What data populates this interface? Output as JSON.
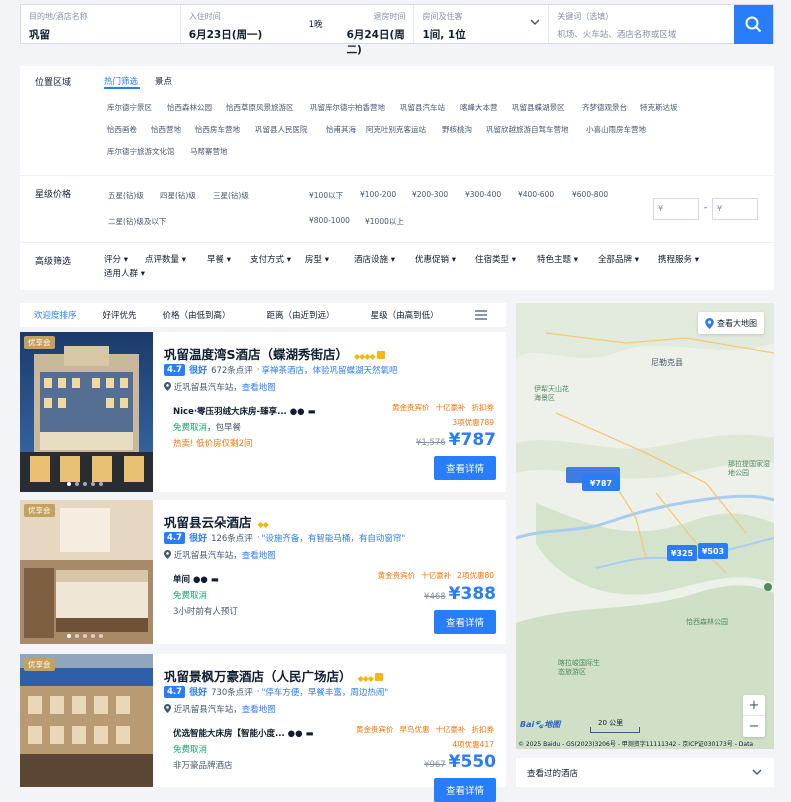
{
  "search": {
    "dest_label": "目的地/酒店名称",
    "dest_value": "巩留",
    "checkin_label": "入住时间",
    "checkin_value": "6月23日(周一)",
    "nights": "1晚",
    "checkout_label": "退房时间",
    "checkout_value": "6月24日(周二)",
    "guests_label": "房间及住客",
    "guests_value": "1间, 1位",
    "keyword_label": "关键词（选填）",
    "keyword_placeholder": "机场、火车站、酒店名称或区域"
  },
  "filters": {
    "location_label": "位置区域",
    "loc_tabs": [
      "热门筛选",
      "景点"
    ],
    "loc_row1": [
      "库尔德宁景区",
      "恰西森林公园",
      "恰西草原风景旅游区",
      "巩留库尔德宁柏香营地",
      "巩留县汽车站",
      "喀峰大本营",
      "巩留县蝶湖景区",
      "齐梦德观景台",
      "特克斯达坂"
    ],
    "loc_row2": [
      "恰西画卷",
      "恰西营地",
      "恰西房车营地",
      "巩留县人民医院",
      "恰甫其海",
      "阿克吐别克客运站",
      "野核桃沟",
      "巩留欣越旅游自驾车营地",
      "小喜山雨房车营地"
    ],
    "loc_row3": [
      "库尔德宁旅游文化馆",
      "马帮寨营地"
    ],
    "star_label": "星级价格",
    "stars_row1": [
      "五星(钻)级",
      "四星(钻)级",
      "三星(钻)级"
    ],
    "stars_row2": [
      "二星(钻)级及以下"
    ],
    "prices_row1": [
      "¥100以下",
      "¥100-200",
      "¥200-300",
      "¥300-400",
      "¥400-600",
      "¥600-800"
    ],
    "prices_row2": [
      "¥800-1000",
      "¥1000以上"
    ],
    "price_min_ph": "¥",
    "price_max_ph": "¥",
    "price_dash": "-",
    "adv_label": "高级筛选",
    "adv_items": [
      "评分",
      "点评数量",
      "早餐",
      "支付方式",
      "房型",
      "酒店设施",
      "优惠促销",
      "住宿类型",
      "特色主题",
      "全部品牌",
      "携程服务",
      "适用人群"
    ]
  },
  "sort": {
    "items": [
      "欢迎度排序",
      "好评优先",
      "价格（由低到高）",
      "距离（由近到远）",
      "星级（由高到低）"
    ]
  },
  "hotels": [
    {
      "badge": "优享会",
      "name": "巩留温度湾S酒店（蝶湖秀街店）",
      "diamonds": "◆◆◆◆",
      "score": "4.7",
      "score_word": "很好",
      "reviews": "672条点评",
      "quote": "享禅茶酒店，体验巩留蝶湖天然氧吧",
      "location": "近巩留县汽车站",
      "map_link": "查看地图",
      "room": "Nice·零压羽绒大床房-臻享...",
      "free_cancel": "免费取消",
      "extra": "包早餐",
      "hot": "热卖! 低价房仅剩2间",
      "promos": [
        "黄金贵宾价",
        "十亿豪补",
        "折扣券"
      ],
      "coupon": "3项优惠789",
      "old_price": "¥1,576",
      "price": "¥787",
      "button": "查看详情"
    },
    {
      "badge": "优享会",
      "name": "巩留县云朵酒店",
      "diamonds": "◆◆",
      "score": "4.7",
      "score_word": "很好",
      "reviews": "126条点评",
      "quote": "\"设施齐备，有智能马桶，有自动窗帘\"",
      "location": "近巩留县汽车站",
      "map_link": "查看地图",
      "room": "单间",
      "free_cancel": "免费取消",
      "extra": "3小时前有人预订",
      "promos": [
        "黄金贵宾价",
        "十亿豪补",
        "2项优惠80"
      ],
      "old_price": "¥468",
      "price": "¥388",
      "button": "查看详情"
    },
    {
      "badge": "优享会",
      "name": "巩留景枫万豪酒店（人民广场店）",
      "diamonds": "◆◆◆",
      "score": "4.7",
      "score_word": "很好",
      "reviews": "730条点评",
      "quote": "\"停车方便，早餐丰富，周边热闹\"",
      "location": "近巩留县汽车站",
      "map_link": "查看地图",
      "room": "优选智能大床房【智能小度...",
      "free_cancel": "免费取消",
      "extra": "非万豪品牌酒店",
      "promos": [
        "黄金贵宾价",
        "早鸟优惠",
        "十亿豪补",
        "折扣券"
      ],
      "coupon": "4项优惠417",
      "old_price": "¥967",
      "price": "¥550",
      "button": "查看详情"
    }
  ],
  "map": {
    "view_big": "查看大地图",
    "labels": [
      "尼勒克县",
      "伊犁天山花海景区",
      "那拉提国家湿地公园",
      "恰西森林公园",
      "喀拉峻国际生态旅游区"
    ],
    "markers": [
      "¥787",
      "¥325",
      "¥503"
    ],
    "scale": "20 公里",
    "copyright": "© 2025 Baidu - GS(2023)3206号 - 甲测资字11111342 - 京ICP证030173号 - Data",
    "zoom_in": "+",
    "zoom_out": "−"
  },
  "history": {
    "label": "查看过的酒店"
  },
  "colors": {
    "accent": "#287dfa",
    "price": "#287dfa",
    "promo": "#ff6f00",
    "green": "#06ae65"
  }
}
